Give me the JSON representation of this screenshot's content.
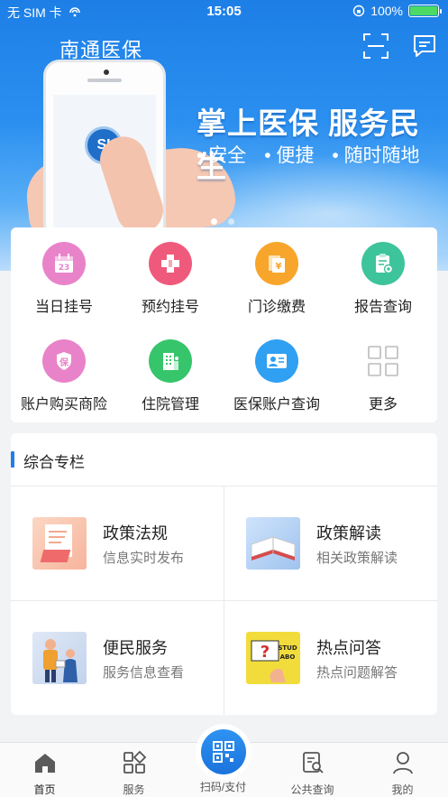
{
  "status_bar": {
    "carrier": "无 SIM 卡",
    "time": "15:05",
    "battery": "100%"
  },
  "header": {
    "title": "南通医保",
    "scan_icon": "scan-frame-icon",
    "message_icon": "chat-bubble-icon"
  },
  "banner": {
    "slogan": "掌上医保 服务民生",
    "tags": [
      "安全",
      "便捷",
      "随时随地"
    ],
    "logo_text": "SI",
    "page_count": 2,
    "active_page": 1
  },
  "services": [
    {
      "label": "当日挂号",
      "icon": "calendar-icon",
      "color": "#e983c9",
      "glyph": "23"
    },
    {
      "label": "预约挂号",
      "icon": "medical-cross-icon",
      "color": "#ef5a7c",
      "glyph": "✚"
    },
    {
      "label": "门诊缴费",
      "icon": "payment-icon",
      "color": "#f8a52b",
      "glyph": "¥"
    },
    {
      "label": "报告查询",
      "icon": "report-icon",
      "color": "#3ec49b",
      "glyph": "✎"
    },
    {
      "label": "账户购买商险",
      "icon": "insurance-shield-icon",
      "color": "#e983c9",
      "glyph": "保"
    },
    {
      "label": "住院管理",
      "icon": "hospital-icon",
      "color": "#37c56b",
      "glyph": "▦"
    },
    {
      "label": "医保账户查询",
      "icon": "account-card-icon",
      "color": "#2fa0f2",
      "glyph": "☰"
    },
    {
      "label": "更多",
      "icon": "more-grid-icon",
      "color": "#ffffff",
      "glyph": ""
    }
  ],
  "section": {
    "title": "综合专栏",
    "tiles": [
      {
        "title": "政策法规",
        "subtitle": "信息实时发布",
        "icon": "policy-document-icon"
      },
      {
        "title": "政策解读",
        "subtitle": "相关政策解读",
        "icon": "open-book-icon"
      },
      {
        "title": "便民服务",
        "subtitle": "服务信息查看",
        "icon": "service-people-icon"
      },
      {
        "title": "热点问答",
        "subtitle": "热点问题解答",
        "icon": "question-board-icon",
        "thumb_text": "STUD ABO"
      }
    ]
  },
  "tabbar": {
    "items": [
      {
        "label": "首页",
        "icon": "home-icon",
        "active": true
      },
      {
        "label": "服务",
        "icon": "services-grid-icon",
        "active": false
      },
      {
        "label": "扫码/支付",
        "icon": "qr-code-icon",
        "active": false
      },
      {
        "label": "公共查询",
        "icon": "search-document-icon",
        "active": false
      },
      {
        "label": "我的",
        "icon": "user-icon",
        "active": false
      }
    ]
  }
}
